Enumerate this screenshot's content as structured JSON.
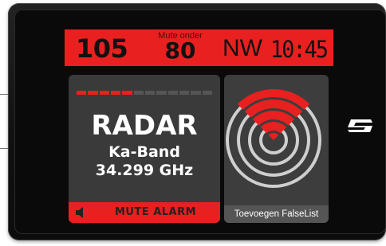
{
  "status": {
    "speed": "105",
    "mute_label": "Mute onder",
    "mute_speed": "80",
    "direction": "NW",
    "time": "10:45"
  },
  "alert": {
    "signal_strength": {
      "active": 5,
      "total": 12
    },
    "type": "RADAR",
    "band": "Ka-Band",
    "frequency": "34.299 GHz",
    "mute_button": "MUTE ALARM"
  },
  "radar_view": {
    "falselist_button": "Toevoegen FalseList"
  },
  "icons": {
    "speaker": "speaker-icon",
    "radar": "radar-icon",
    "logo": "brand-logo-icon"
  },
  "colors": {
    "accent_red": "#e8201f",
    "panel_gray": "#3a3a3a",
    "frame": "#111111"
  }
}
